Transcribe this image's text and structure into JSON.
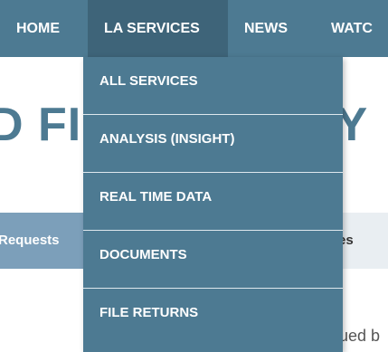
{
  "navbar": {
    "items": [
      {
        "label": "HOME"
      },
      {
        "label": "LA SERVICES"
      },
      {
        "label": "NEWS"
      },
      {
        "label": "WATC"
      }
    ]
  },
  "background": {
    "title_left": "D FIL",
    "title_right": "BY",
    "tab_active": "Requests",
    "tab_right": "es",
    "bottom_text": "ued b"
  },
  "dropdown": {
    "items": [
      {
        "label": "ALL SERVICES"
      },
      {
        "label": "ANALYSIS (INSIGHT)"
      },
      {
        "label": "REAL TIME DATA"
      },
      {
        "label": "DOCUMENTS"
      },
      {
        "label": "FILE RETURNS"
      }
    ]
  },
  "colors": {
    "nav_bg": "#4d7a92",
    "nav_active_bg": "#3e6479",
    "tab_active_bg": "#7c9fba"
  }
}
